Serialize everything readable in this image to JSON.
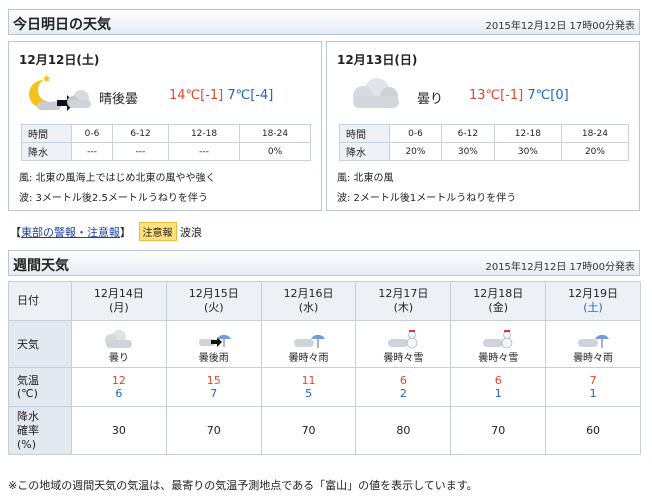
{
  "today_bar": {
    "title": "今日明日の天気",
    "stamp": "2015年12月12日 17時00分発表"
  },
  "days": [
    {
      "date": "12月12日(土)",
      "icon": "sunny-then-cloudy-night-icon",
      "weather": "晴後曇",
      "high": "14℃[-1]",
      "low": "7℃[-4]",
      "rain_periods": [
        "0-6",
        "6-12",
        "12-18",
        "18-24"
      ],
      "rain_values": [
        "---",
        "---",
        "---",
        "0%"
      ],
      "row_time": "時間",
      "row_rain": "降水",
      "wind": "風: 北東の風海上ではじめ北東の風やや強く",
      "wave": "波: 3メートル後2.5メートルうねりを伴う"
    },
    {
      "date": "12月13日(日)",
      "icon": "cloudy-icon",
      "weather": "曇り",
      "high": "13℃[-1]",
      "low": "7℃[0]",
      "rain_periods": [
        "0-6",
        "6-12",
        "12-18",
        "18-24"
      ],
      "rain_values": [
        "20%",
        "30%",
        "30%",
        "20%"
      ],
      "row_time": "時間",
      "row_rain": "降水",
      "wind": "風: 北東の風",
      "wave": "波: 2メートル後1メートルうねりを伴う"
    }
  ],
  "warning": {
    "link": "東部の警報・注意報",
    "bracket_l": "【",
    "bracket_r": "】",
    "badge": "注意報",
    "type": "波浪"
  },
  "weekly_bar": {
    "title": "週間天気",
    "stamp": "2015年12月12日 17時00分発表"
  },
  "weekly": {
    "row_labels": {
      "date": "日付",
      "weather": "天気",
      "temp_l1": "気温",
      "temp_l2": "(℃)",
      "rain_l1": "降水",
      "rain_l2": "確率",
      "rain_l3": "(%)"
    },
    "days": [
      {
        "date": "12月14日",
        "dow": "(月)",
        "icon": "cloudy-icon",
        "weather": "曇り",
        "high": "12",
        "low": "6",
        "rain": "30"
      },
      {
        "date": "12月15日",
        "dow": "(火)",
        "icon": "cloudy-then-rain-icon",
        "weather": "曇後雨",
        "high": "15",
        "low": "7",
        "rain": "70"
      },
      {
        "date": "12月16日",
        "dow": "(水)",
        "icon": "cloudy-occasional-rain-icon",
        "weather": "曇時々雨",
        "high": "11",
        "low": "5",
        "rain": "70"
      },
      {
        "date": "12月17日",
        "dow": "(木)",
        "icon": "cloudy-occasional-snow-icon",
        "weather": "曇時々雪",
        "high": "6",
        "low": "2",
        "rain": "80"
      },
      {
        "date": "12月18日",
        "dow": "(金)",
        "icon": "cloudy-occasional-snow-icon",
        "weather": "曇時々雪",
        "high": "6",
        "low": "1",
        "rain": "70"
      },
      {
        "date": "12月19日",
        "dow": "(土)",
        "icon": "cloudy-occasional-rain-icon",
        "weather": "曇時々雨",
        "high": "7",
        "low": "1",
        "rain": "60"
      }
    ]
  },
  "footnote": "※この地域の週間天気の気温は、最寄りの気温予測地点である「富山」の値を表示しています。"
}
